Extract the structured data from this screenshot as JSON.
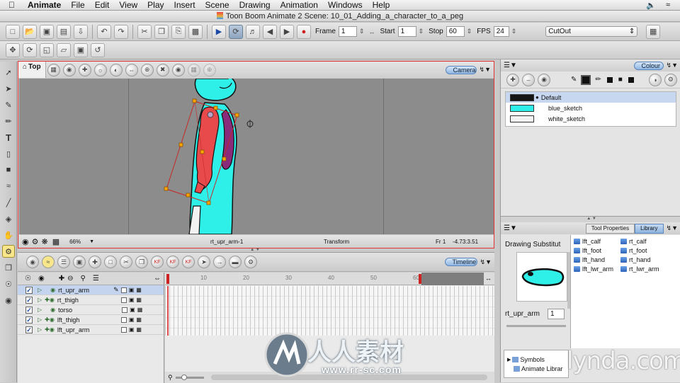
{
  "menubar": {
    "app_name": "Animate",
    "items": [
      "File",
      "Edit",
      "View",
      "Play",
      "Insert",
      "Scene",
      "Drawing",
      "Animation",
      "Windows",
      "Help"
    ]
  },
  "window": {
    "title": "Toon Boom Animate 2 Scene: 10_01_Adding_a_character_to_a_peg"
  },
  "playback": {
    "frame_label": "Frame",
    "frame_value": "1",
    "start_label": "Start",
    "start_value": "1",
    "stop_label": "Stop",
    "stop_value": "60",
    "fps_label": "FPS",
    "fps_value": "24"
  },
  "workspace": {
    "selected": "CutOut"
  },
  "camera_view": {
    "view_tab": "Top",
    "panel_tab": "Camera",
    "zoom": "66%",
    "selected_element": "rt_upr_arm-1",
    "mode": "Transform",
    "frame_info": "Fr 1",
    "coordinates": "-4.73:3.51"
  },
  "timeline": {
    "panel_tab": "Timeline",
    "ruler_ticks": [
      "10",
      "20",
      "30",
      "40",
      "50",
      "60"
    ],
    "layers": [
      {
        "name": "rt_upr_arm",
        "selected": true
      },
      {
        "name": "rt_thigh",
        "selected": false
      },
      {
        "name": "torso",
        "selected": false
      },
      {
        "name": "lft_thigh",
        "selected": false
      },
      {
        "name": "lft_upr_arm",
        "selected": false
      }
    ]
  },
  "colour_panel": {
    "panel_tab": "Colour",
    "palette": [
      {
        "name": "Default",
        "color": "#151515",
        "selected": true
      },
      {
        "name": "blue_sketch",
        "color": "#2ef0e8",
        "selected": false
      },
      {
        "name": "white_sketch",
        "color": "#f2f2f2",
        "selected": false
      }
    ]
  },
  "library_panel": {
    "tabs": [
      "Tool Properties",
      "Library"
    ],
    "active_tab": "Library",
    "drawing_substitution_label": "Drawing Substitut",
    "drawing_name": "rt_upr_arm",
    "drawing_value": "1",
    "items_col1": [
      "lft_calf",
      "lft_foot",
      "lft_hand",
      "lft_lwr_arm"
    ],
    "items_col2": [
      "rt_calf",
      "rt_foot",
      "rt_hand",
      "rt_lwr_arm"
    ],
    "tree": [
      "Symbols",
      "Animate Librar"
    ]
  },
  "branding": {
    "lynda": "lynda.com",
    "watermark_title": "人人素材",
    "watermark_url": "www.rr-sc.com"
  },
  "colors": {
    "character_body": "#2ef0e8",
    "arm_red": "#e8494a",
    "stage_bg": "#8c8c8c",
    "selection_red": "#c62828",
    "accent_blue": "#8fb6e2"
  },
  "icons": [
    "apple-icon",
    "volume-icon",
    "wifi-icon",
    "play-icon",
    "loop-icon",
    "select-arrow-icon",
    "brush-icon",
    "pencil-icon",
    "text-icon",
    "eraser-icon",
    "paint-bucket-icon",
    "transform-icon",
    "camera-icon",
    "onion-skin-icon",
    "keyframe-icon",
    "lock-icon",
    "folder-icon"
  ]
}
